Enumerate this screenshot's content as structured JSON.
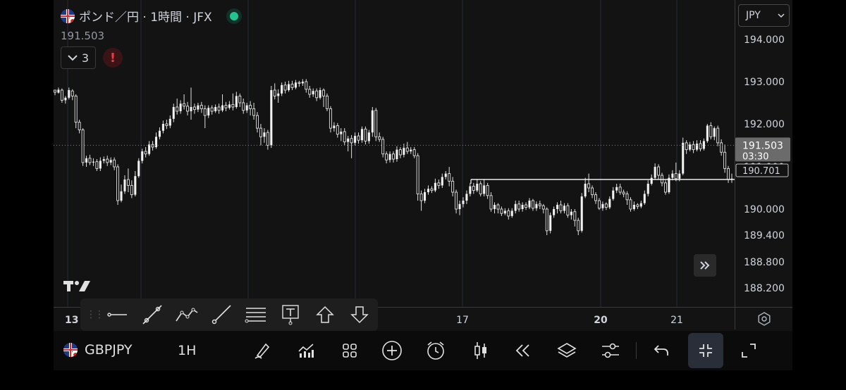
{
  "header": {
    "title": "ポンド／円 · 1時間 · JFX",
    "last_price": "191.503",
    "indicator_count": "3",
    "alert_label": "!"
  },
  "currency": {
    "selected": "JPY"
  },
  "price_axis": {
    "ticks": [
      "194.000",
      "193.000",
      "192.000",
      "191.000",
      "190.000",
      "189.400",
      "188.800",
      "188.200"
    ],
    "current_price": "191.503",
    "countdown": "03:30",
    "line_price": "190.701"
  },
  "time_axis": {
    "labels": [
      "13",
      "17",
      "20",
      "21"
    ]
  },
  "drawing_toolbar": {
    "tools": [
      "horizontal-line",
      "trend-line",
      "path",
      "ray",
      "parallel-channel",
      "text",
      "arrow-up",
      "arrow-down"
    ]
  },
  "bottom_bar": {
    "symbol": "GBPJPY",
    "timeframe": "1H",
    "tools": [
      "brush",
      "indicators",
      "templates",
      "add",
      "alert",
      "candles",
      "replay",
      "layers",
      "settings",
      "undo",
      "collapse",
      "fullscreen"
    ]
  },
  "chart_data": {
    "type": "candlestick",
    "ylim": [
      188.0,
      194.3
    ],
    "horizontal_line": 190.701,
    "last_price": 191.503,
    "candles": [
      [
        192.8,
        192.75,
        192.78,
        192.68
      ],
      [
        192.74,
        192.81,
        192.86,
        192.72
      ],
      [
        192.8,
        192.56,
        192.84,
        192.5
      ],
      [
        192.56,
        192.62,
        192.66,
        192.48
      ],
      [
        192.62,
        192.8,
        192.86,
        192.58
      ],
      [
        192.78,
        192.66,
        192.82,
        192.56
      ],
      [
        192.66,
        192.04,
        192.7,
        191.9
      ],
      [
        192.04,
        191.86,
        192.1,
        191.78
      ],
      [
        191.86,
        191.1,
        191.9,
        191.02
      ],
      [
        191.1,
        191.2,
        191.26,
        191.0
      ],
      [
        191.2,
        191.1,
        191.28,
        191.04
      ],
      [
        191.1,
        191.12,
        191.2,
        191.02
      ],
      [
        191.12,
        190.96,
        191.18,
        190.9
      ],
      [
        190.96,
        191.14,
        191.22,
        190.9
      ],
      [
        191.14,
        191.18,
        191.24,
        191.08
      ],
      [
        191.18,
        191.1,
        191.26,
        191.02
      ],
      [
        191.1,
        191.16,
        191.22,
        191.04
      ],
      [
        191.16,
        191.0,
        191.22,
        190.92
      ],
      [
        191.0,
        190.2,
        191.06,
        190.1
      ],
      [
        190.2,
        190.42,
        190.58,
        190.16
      ],
      [
        190.42,
        190.7,
        190.8,
        190.36
      ],
      [
        190.7,
        190.56,
        190.96,
        190.4
      ],
      [
        190.56,
        190.34,
        190.68,
        190.26
      ],
      [
        190.34,
        190.78,
        190.9,
        190.3
      ],
      [
        190.78,
        191.14,
        191.2,
        190.74
      ],
      [
        191.14,
        191.36,
        191.42,
        191.08
      ],
      [
        191.36,
        191.3,
        191.46,
        191.22
      ],
      [
        191.3,
        191.52,
        191.6,
        191.26
      ],
      [
        191.52,
        191.46,
        191.6,
        191.38
      ],
      [
        191.46,
        191.7,
        191.8,
        191.42
      ],
      [
        191.7,
        191.84,
        191.92,
        191.64
      ],
      [
        191.84,
        192.0,
        192.08,
        191.78
      ],
      [
        192.0,
        191.96,
        192.1,
        191.88
      ],
      [
        191.96,
        192.12,
        192.2,
        191.9
      ],
      [
        192.12,
        192.4,
        192.48,
        192.04
      ],
      [
        192.4,
        192.3,
        192.6,
        192.22
      ],
      [
        192.3,
        192.48,
        192.56,
        192.24
      ],
      [
        192.48,
        192.42,
        192.7,
        192.34
      ],
      [
        192.42,
        192.3,
        192.52,
        192.2
      ],
      [
        192.3,
        192.4,
        192.86,
        192.1
      ],
      [
        192.4,
        192.34,
        192.48,
        192.24
      ],
      [
        192.34,
        192.44,
        192.5,
        192.28
      ],
      [
        192.44,
        192.36,
        192.52,
        192.26
      ],
      [
        192.36,
        192.2,
        192.44,
        191.9
      ],
      [
        192.2,
        192.38,
        192.44,
        192.14
      ],
      [
        192.38,
        192.3,
        192.44,
        192.22
      ],
      [
        192.3,
        192.4,
        192.46,
        192.26
      ],
      [
        192.4,
        192.32,
        192.48,
        192.24
      ],
      [
        192.32,
        192.44,
        192.7,
        192.28
      ],
      [
        192.44,
        192.38,
        192.52,
        192.3
      ],
      [
        192.38,
        192.46,
        192.54,
        192.34
      ],
      [
        192.46,
        192.4,
        192.72,
        192.32
      ],
      [
        192.4,
        192.66,
        192.76,
        192.36
      ],
      [
        192.66,
        192.5,
        192.72,
        192.4
      ],
      [
        192.5,
        192.32,
        192.6,
        192.24
      ],
      [
        192.32,
        192.44,
        192.5,
        192.26
      ],
      [
        192.44,
        192.36,
        192.54,
        192.2
      ],
      [
        192.36,
        192.2,
        192.5,
        192.1
      ],
      [
        192.2,
        191.9,
        192.28,
        191.8
      ],
      [
        191.9,
        191.7,
        192.0,
        191.5
      ],
      [
        191.7,
        191.8,
        191.9,
        191.56
      ],
      [
        191.8,
        191.5,
        191.86,
        191.4
      ],
      [
        191.5,
        192.8,
        192.9,
        191.44
      ],
      [
        192.8,
        192.66,
        192.96,
        192.58
      ],
      [
        192.66,
        192.72,
        192.82,
        192.5
      ],
      [
        192.72,
        192.92,
        192.98,
        192.66
      ],
      [
        192.92,
        192.8,
        193.0,
        192.72
      ],
      [
        192.8,
        192.94,
        193.02,
        192.76
      ],
      [
        192.94,
        192.86,
        193.02,
        192.8
      ],
      [
        192.86,
        192.98,
        193.04,
        192.82
      ],
      [
        192.98,
        192.96,
        193.02,
        192.88
      ],
      [
        192.96,
        193.0,
        193.06,
        192.9
      ],
      [
        193.0,
        192.82,
        193.06,
        192.74
      ],
      [
        192.82,
        192.7,
        192.9,
        192.62
      ],
      [
        192.7,
        192.78,
        192.84,
        192.64
      ],
      [
        192.78,
        192.62,
        192.84,
        192.54
      ],
      [
        192.62,
        192.8,
        192.86,
        192.58
      ],
      [
        192.8,
        192.66,
        192.84,
        192.4
      ],
      [
        192.66,
        192.36,
        192.72,
        192.3
      ],
      [
        192.36,
        191.9,
        192.42,
        191.8
      ],
      [
        191.9,
        191.96,
        192.04,
        191.82
      ],
      [
        191.96,
        191.76,
        192.02,
        191.68
      ],
      [
        191.76,
        191.82,
        191.9,
        191.6
      ],
      [
        191.82,
        191.58,
        191.9,
        191.5
      ],
      [
        191.58,
        191.66,
        191.72,
        191.36
      ],
      [
        191.66,
        191.56,
        191.74,
        191.2
      ],
      [
        191.56,
        191.72,
        191.8,
        191.5
      ],
      [
        191.72,
        191.62,
        191.8,
        191.54
      ],
      [
        191.62,
        191.88,
        191.94,
        191.56
      ],
      [
        191.88,
        191.6,
        191.94,
        191.52
      ],
      [
        191.6,
        191.8,
        191.86,
        191.54
      ],
      [
        191.8,
        192.32,
        192.4,
        191.7
      ],
      [
        192.32,
        191.7,
        192.38,
        191.6
      ],
      [
        191.7,
        191.64,
        191.8,
        191.58
      ],
      [
        191.64,
        191.3,
        191.7,
        191.22
      ],
      [
        191.3,
        191.16,
        191.36,
        191.08
      ],
      [
        191.16,
        191.3,
        191.36,
        191.1
      ],
      [
        191.3,
        191.18,
        191.36,
        191.1
      ],
      [
        191.18,
        191.4,
        191.48,
        191.12
      ],
      [
        191.4,
        191.28,
        191.46,
        191.2
      ],
      [
        191.28,
        191.44,
        191.54,
        191.22
      ],
      [
        191.44,
        191.36,
        191.58,
        191.3
      ],
      [
        191.36,
        191.4,
        191.46,
        191.3
      ],
      [
        191.4,
        191.26,
        191.46,
        191.2
      ],
      [
        191.26,
        190.36,
        191.32,
        190.2
      ],
      [
        190.36,
        190.2,
        190.44,
        189.96
      ],
      [
        190.2,
        190.4,
        190.48,
        190.14
      ],
      [
        190.4,
        190.48,
        190.56,
        190.34
      ],
      [
        190.48,
        190.44,
        190.54,
        190.38
      ],
      [
        190.44,
        190.62,
        190.72,
        190.4
      ],
      [
        190.62,
        190.56,
        190.7,
        190.48
      ],
      [
        190.56,
        190.76,
        190.84,
        190.5
      ],
      [
        190.76,
        190.84,
        190.9,
        190.7
      ],
      [
        190.84,
        190.66,
        191.0,
        190.54
      ],
      [
        190.66,
        190.4,
        190.76,
        190.3
      ],
      [
        190.4,
        190.0,
        190.46,
        189.9
      ],
      [
        190.0,
        190.12,
        190.2,
        189.86
      ],
      [
        190.12,
        190.2,
        190.28,
        190.04
      ],
      [
        190.2,
        190.36,
        190.44,
        190.12
      ],
      [
        190.36,
        190.54,
        190.62,
        190.3
      ],
      [
        190.54,
        190.44,
        190.62,
        190.36
      ],
      [
        190.44,
        190.6,
        190.7,
        190.4
      ],
      [
        190.6,
        190.36,
        190.66,
        190.3
      ],
      [
        190.36,
        190.56,
        190.7,
        190.3
      ],
      [
        190.56,
        190.32,
        190.62,
        190.24
      ],
      [
        190.32,
        190.0,
        190.4,
        189.94
      ],
      [
        190.0,
        190.1,
        190.16,
        189.9
      ],
      [
        190.1,
        190.0,
        190.14,
        189.9
      ],
      [
        190.0,
        189.9,
        190.06,
        189.84
      ],
      [
        189.9,
        189.96,
        190.02,
        189.86
      ],
      [
        189.96,
        189.84,
        190.02,
        189.76
      ],
      [
        189.84,
        189.96,
        190.02,
        189.8
      ],
      [
        189.96,
        190.12,
        190.2,
        189.9
      ],
      [
        190.12,
        190.0,
        190.2,
        189.94
      ],
      [
        190.0,
        190.1,
        190.16,
        189.94
      ],
      [
        190.1,
        190.04,
        190.16,
        189.98
      ],
      [
        190.04,
        190.2,
        190.26,
        190.0
      ],
      [
        190.2,
        190.02,
        190.24,
        189.96
      ],
      [
        190.02,
        190.12,
        190.18,
        189.96
      ],
      [
        190.12,
        190.08,
        190.2,
        190.0
      ],
      [
        190.08,
        190.0,
        190.12,
        189.9
      ],
      [
        190.0,
        189.5,
        190.04,
        189.4
      ],
      [
        189.5,
        189.86,
        189.92,
        189.44
      ],
      [
        189.86,
        190.0,
        190.06,
        189.8
      ],
      [
        190.0,
        190.1,
        190.16,
        189.9
      ],
      [
        190.1,
        189.96,
        190.2,
        189.9
      ],
      [
        189.96,
        190.08,
        190.14,
        189.9
      ],
      [
        190.08,
        189.86,
        190.14,
        189.8
      ],
      [
        189.86,
        189.94,
        190.0,
        189.76
      ],
      [
        189.94,
        189.74,
        190.0,
        189.6
      ],
      [
        189.74,
        189.5,
        189.8,
        189.4
      ],
      [
        189.5,
        190.3,
        190.38,
        189.46
      ],
      [
        190.3,
        190.6,
        190.74,
        190.26
      ],
      [
        190.6,
        190.5,
        190.84,
        190.4
      ],
      [
        190.5,
        190.34,
        190.56,
        190.26
      ],
      [
        190.34,
        190.2,
        190.4,
        190.12
      ],
      [
        190.2,
        190.02,
        190.26,
        189.98
      ],
      [
        190.02,
        190.12,
        190.18,
        189.96
      ],
      [
        190.12,
        190.04,
        190.16,
        189.98
      ],
      [
        190.04,
        190.24,
        190.3,
        190.0
      ],
      [
        190.24,
        190.44,
        190.52,
        190.2
      ],
      [
        190.44,
        190.52,
        190.6,
        190.38
      ],
      [
        190.52,
        190.4,
        190.6,
        190.34
      ],
      [
        190.4,
        190.36,
        190.46,
        190.28
      ],
      [
        190.36,
        190.22,
        190.42,
        190.1
      ],
      [
        190.22,
        190.0,
        190.28,
        189.94
      ],
      [
        190.0,
        190.1,
        190.18,
        189.96
      ],
      [
        190.1,
        190.06,
        190.14,
        190.0
      ],
      [
        190.06,
        190.14,
        190.2,
        190.02
      ],
      [
        190.14,
        190.36,
        190.44,
        190.1
      ],
      [
        190.36,
        190.6,
        190.68,
        190.3
      ],
      [
        190.6,
        190.74,
        190.82,
        190.56
      ],
      [
        190.74,
        191.0,
        191.08,
        190.7
      ],
      [
        191.0,
        190.8,
        191.06,
        190.7
      ],
      [
        190.8,
        190.62,
        190.86,
        190.54
      ],
      [
        190.62,
        190.4,
        190.68,
        190.34
      ],
      [
        190.4,
        190.74,
        190.82,
        190.36
      ],
      [
        190.74,
        190.84,
        190.92,
        190.68
      ],
      [
        190.84,
        190.72,
        191.1,
        190.66
      ],
      [
        190.72,
        190.84,
        190.92,
        190.66
      ],
      [
        190.84,
        191.56,
        191.68,
        190.8
      ],
      [
        191.56,
        191.4,
        191.62,
        191.3
      ],
      [
        191.4,
        191.52,
        191.58,
        191.36
      ],
      [
        191.52,
        191.4,
        191.6,
        191.32
      ],
      [
        191.4,
        191.54,
        191.62,
        191.36
      ],
      [
        191.54,
        191.42,
        191.62,
        191.36
      ],
      [
        191.42,
        191.6,
        191.66,
        191.38
      ],
      [
        191.6,
        191.96,
        192.0,
        191.56
      ],
      [
        191.96,
        191.7,
        192.04,
        191.64
      ],
      [
        191.7,
        191.9,
        191.94,
        191.62
      ],
      [
        191.9,
        191.56,
        191.96,
        191.48
      ],
      [
        191.56,
        191.34,
        191.64,
        191.26
      ],
      [
        191.34,
        190.96,
        191.52,
        190.86
      ],
      [
        190.96,
        190.7,
        191.02,
        190.62
      ],
      [
        190.7,
        190.72,
        190.84,
        190.62
      ]
    ]
  }
}
